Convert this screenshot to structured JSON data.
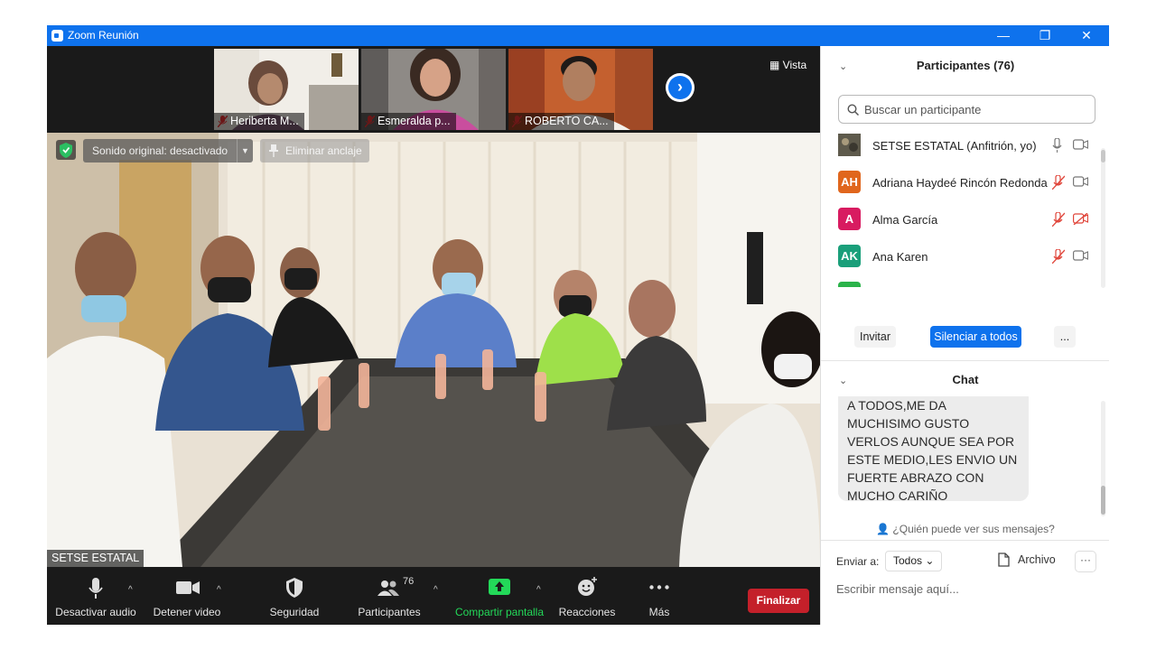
{
  "window": {
    "title": "Zoom Reunión",
    "minimize": "—",
    "restore": "❐",
    "close": "✕"
  },
  "video": {
    "view_button": "Vista",
    "thumbnails": [
      {
        "name": "Heriberta M...",
        "bg": "#6b5a4e"
      },
      {
        "name": "Esmeralda p...",
        "bg": "#8a6a70"
      },
      {
        "name": "ROBERTO CA...",
        "bg": "#8a4a32"
      }
    ],
    "original_sound": "Sonido original: desactivado",
    "unpin": "Eliminar anclaje",
    "active_speaker": "SETSE ESTATAL"
  },
  "toolbar": {
    "mute": "Desactivar audio",
    "stop_video": "Detener video",
    "security": "Seguridad",
    "participants": "Participantes",
    "participants_count": "76",
    "share": "Compartir pantalla",
    "reactions": "Reacciones",
    "more": "Más",
    "end": "Finalizar"
  },
  "participants_panel": {
    "title": "Participantes (76)",
    "search_placeholder": "Buscar un participante",
    "list": [
      {
        "initials": "",
        "name": "SETSE ESTATAL (Anfitrión, yo)",
        "color": "#6b6b5a",
        "mic": "on",
        "cam": "on"
      },
      {
        "initials": "AH",
        "name": "Adriana Haydeé Rincón Redonda",
        "color": "#e0661d",
        "mic": "muted",
        "cam": "on"
      },
      {
        "initials": "A",
        "name": "Alma García",
        "color": "#d81b60",
        "mic": "muted",
        "cam": "off"
      },
      {
        "initials": "AK",
        "name": "Ana Karen",
        "color": "#1a9f7a",
        "mic": "muted",
        "cam": "on"
      }
    ],
    "invite": "Invitar",
    "mute_all": "Silenciar a todos",
    "more": "..."
  },
  "chat": {
    "title": "Chat",
    "message": "A TODOS,ME DA MUCHISIMO GUSTO VERLOS AUNQUE SEA POR ESTE MEDIO,LES ENVIO UN FUERTE ABRAZO CON MUCHO CARIÑO",
    "who_can_see": "¿Quién puede ver sus mensajes?",
    "send_to_label": "Enviar a:",
    "send_to_value": "Todos",
    "file": "Archivo",
    "more": "···",
    "input_placeholder": "Escribir mensaje aquí..."
  },
  "colors": {
    "zoom_blue": "#0e72ed",
    "end_red": "#c4202a",
    "share_green": "#23d959"
  }
}
